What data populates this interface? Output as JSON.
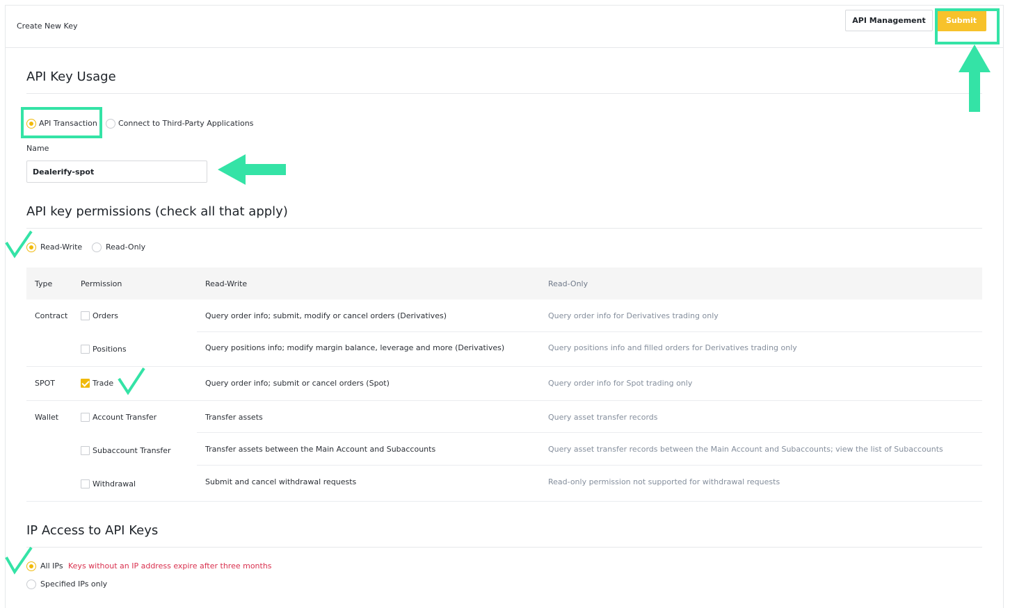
{
  "header": {
    "title": "Create New Key",
    "api_management_label": "API Management",
    "submit_label": "Submit"
  },
  "usage": {
    "title": "API Key Usage",
    "options": [
      {
        "label": "API Transaction",
        "selected": true
      },
      {
        "label": "Connect to Third-Party Applications",
        "selected": false
      }
    ],
    "name_label": "Name",
    "name_value": "Dealerify-spot"
  },
  "permissions": {
    "title": "API key permissions (check all that apply)",
    "mode_options": [
      {
        "label": "Read-Write",
        "selected": true
      },
      {
        "label": "Read-Only",
        "selected": false
      }
    ],
    "columns": [
      "Type",
      "Permission",
      "Read-Write",
      "Read-Only"
    ],
    "rows": [
      {
        "type": "Contract",
        "permission": "Orders",
        "checked": false,
        "read_write": "Query order info; submit, modify or cancel orders (Derivatives)",
        "read_only": "Query order info for Derivatives trading only"
      },
      {
        "type": "",
        "permission": "Positions",
        "checked": false,
        "read_write": "Query positions info; modify margin balance, leverage and more (Derivatives)",
        "read_only": "Query positions info and filled orders for Derivatives trading only"
      },
      {
        "type": "SPOT",
        "permission": "Trade",
        "checked": true,
        "read_write": "Query order info; submit or cancel orders (Spot)",
        "read_only": "Query order info for Spot trading only"
      },
      {
        "type": "Wallet",
        "permission": "Account Transfer",
        "checked": false,
        "read_write": "Transfer assets",
        "read_only": "Query asset transfer records"
      },
      {
        "type": "",
        "permission": "Subaccount Transfer",
        "checked": false,
        "read_write": "Transfer assets between the Main Account and Subaccounts",
        "read_only": "Query asset transfer records between the Main Account and Subaccounts; view the list of Subaccounts"
      },
      {
        "type": "",
        "permission": "Withdrawal",
        "checked": false,
        "read_write": "Submit and cancel withdrawal requests",
        "read_only": "Read-only permission not supported for withdrawal requests"
      }
    ]
  },
  "ip_access": {
    "title": "IP Access to API Keys",
    "options": [
      {
        "label": "All IPs",
        "selected": true,
        "note": "Keys without an IP address expire after three months"
      },
      {
        "label": "Specified IPs only",
        "selected": false
      }
    ]
  },
  "colors": {
    "accent": "#f0b90b",
    "submit_bg": "#f7c22b",
    "annotation": "#34e3a6",
    "warning": "#d9304e"
  }
}
